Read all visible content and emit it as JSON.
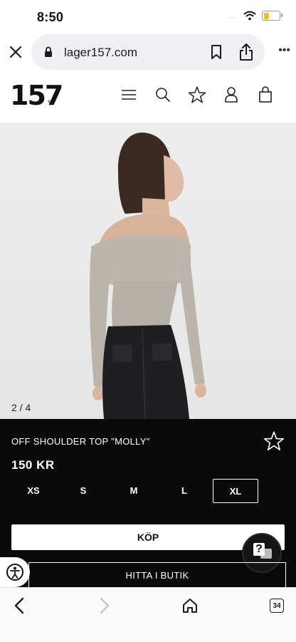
{
  "status_bar": {
    "time": "8:50",
    "signal": "....",
    "battery_level": 0.35,
    "battery_color": "#f5c400"
  },
  "browser": {
    "url": "lager157.com",
    "icons": [
      "close-icon",
      "lock-icon",
      "bookmark-icon",
      "share-icon",
      "more-icon"
    ],
    "more_label": "•••"
  },
  "site": {
    "logo": "157",
    "logo_mark": "®",
    "header_icons": [
      "menu-icon",
      "search-icon",
      "star-icon",
      "user-icon",
      "bag-icon"
    ]
  },
  "product": {
    "image_counter": "2 / 4",
    "name": "OFF SHOULDER TOP \"MOLLY\"",
    "price": "150 KR",
    "sizes": [
      "XS",
      "S",
      "M",
      "L",
      "XL"
    ],
    "selected_size": "XL",
    "buy_label": "KÖP",
    "find_store_label": "HITTA I BUTIK",
    "chat_label": "?"
  },
  "toolbar": {
    "tabs_count": "34",
    "icons": [
      "back-icon",
      "forward-icon",
      "home-icon",
      "tabs-icon"
    ]
  },
  "colors": {
    "panel": "#0a0a0a",
    "accent": "#ffffff",
    "top_color": "#bdb6ae",
    "jeans": "#1f1f22"
  }
}
